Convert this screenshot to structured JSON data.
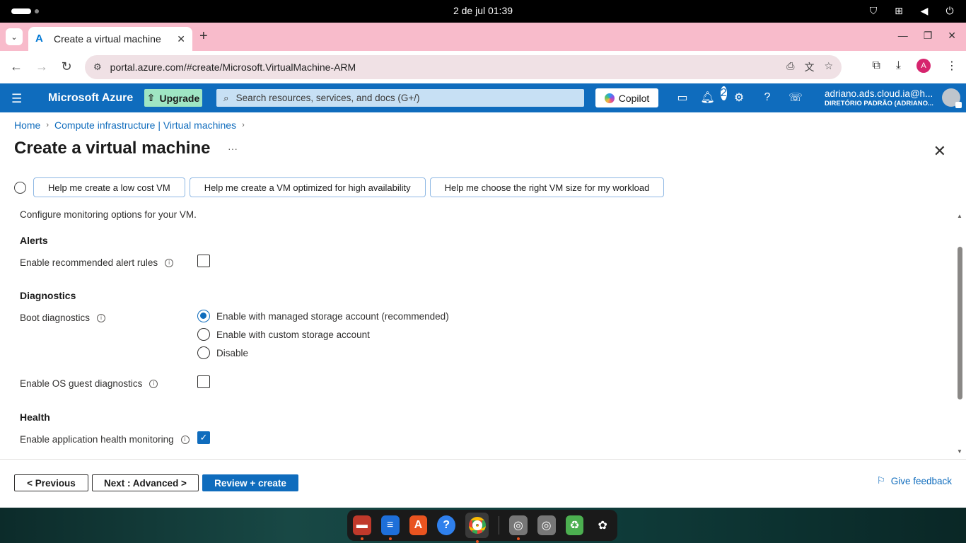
{
  "os": {
    "clock": "2 de jul  01:39",
    "tray_icons": [
      "shield-icon",
      "network-icon",
      "volume-icon",
      "power-icon"
    ]
  },
  "browser": {
    "tab_title": "Create a virtual machine",
    "tab_close": "✕",
    "new_tab": "+",
    "url": "portal.azure.com/#create/Microsoft.VirtualMachine-ARM",
    "profile_initial": "A",
    "accent_color": "#f8bbcb"
  },
  "azure": {
    "brand": "Microsoft Azure",
    "upgrade_label": "Upgrade",
    "search_placeholder": "Search resources, services, and docs (G+/)",
    "copilot_label": "Copilot",
    "notification_count": "2",
    "user_name": "adriano.ads.cloud.ia@h...",
    "user_directory": "DIRETÓRIO PADRÃO (ADRIANO...",
    "header_color": "#0f6cbd"
  },
  "breadcrumb": {
    "home": "Home",
    "compute": "Compute infrastructure | Virtual machines"
  },
  "page": {
    "title": "Create a virtual machine",
    "more": "···",
    "suggestions": [
      "Help me create a low cost VM",
      "Help me create a VM optimized for high availability",
      "Help me choose the right VM size for my workload"
    ]
  },
  "monitoring": {
    "description": "Configure monitoring options for your VM.",
    "alerts_heading": "Alerts",
    "alert_rules_label": "Enable recommended alert rules",
    "alert_rules_checked": false,
    "diagnostics_heading": "Diagnostics",
    "boot_diag_label": "Boot diagnostics",
    "boot_options": [
      "Enable with managed storage account (recommended)",
      "Enable with custom storage account",
      "Disable"
    ],
    "boot_selected": "Enable with managed storage account (recommended)",
    "os_guest_label": "Enable OS guest diagnostics",
    "os_guest_checked": false,
    "health_heading": "Health",
    "app_health_label": "Enable application health monitoring",
    "app_health_checked": true
  },
  "footer": {
    "previous": "< Previous",
    "next": "Next : Advanced >",
    "review": "Review + create",
    "feedback": "Give feedback"
  }
}
